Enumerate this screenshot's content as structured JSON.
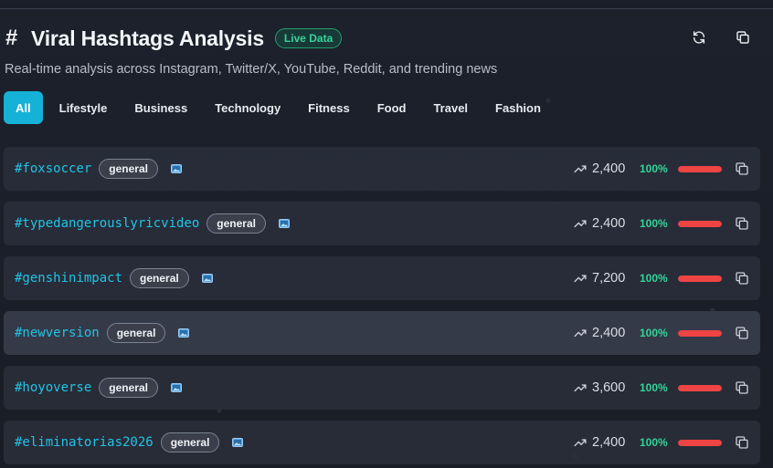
{
  "header": {
    "title": "Viral Hashtags Analysis",
    "badge": "Live Data",
    "subtitle": "Real-time analysis across Instagram, Twitter/X, YouTube, Reddit, and trending news",
    "icons": {
      "title": "hash-icon",
      "refresh": "refresh-icon",
      "copy_all": "copy-icon"
    }
  },
  "tabs": [
    {
      "label": "All",
      "active": true
    },
    {
      "label": "Lifestyle"
    },
    {
      "label": "Business"
    },
    {
      "label": "Technology"
    },
    {
      "label": "Fitness"
    },
    {
      "label": "Food"
    },
    {
      "label": "Travel"
    },
    {
      "label": "Fashion"
    }
  ],
  "hashtags": [
    {
      "tag": "#foxsoccer",
      "category": "general",
      "count": "2,400",
      "percent": "100%",
      "bar_fraction": 1.0
    },
    {
      "tag": "#typedangerouslyricvideo",
      "category": "general",
      "count": "2,400",
      "percent": "100%",
      "bar_fraction": 1.0
    },
    {
      "tag": "#genshinimpact",
      "category": "general",
      "count": "7,200",
      "percent": "100%",
      "bar_fraction": 1.0
    },
    {
      "tag": "#newversion",
      "category": "general",
      "count": "2,400",
      "percent": "100%",
      "bar_fraction": 1.0,
      "hover": true
    },
    {
      "tag": "#hoyoverse",
      "category": "general",
      "count": "3,600",
      "percent": "100%",
      "bar_fraction": 1.0
    },
    {
      "tag": "#eliminatorias2026",
      "category": "general",
      "count": "2,400",
      "percent": "100%",
      "bar_fraction": 1.0
    }
  ],
  "colors": {
    "accent": "#16b1d6",
    "tag": "#22c3e6",
    "live": "#34d399",
    "bar": "#ef4444"
  }
}
